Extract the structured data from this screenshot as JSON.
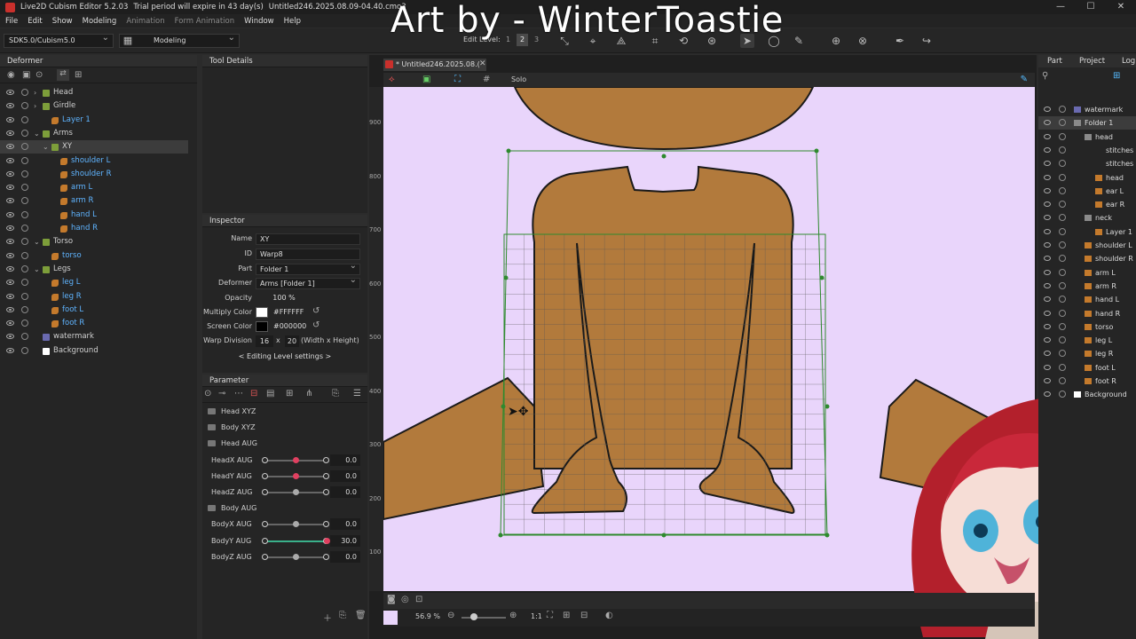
{
  "window": {
    "app_title": "Live2D Cubism Editor 5.2.03",
    "trial_text": "Trial period will expire in 43 day(s)",
    "file_title": "Untitled246.2025.08.09-04.40.cmo3"
  },
  "watermark": "Art by - WinterToastie",
  "menu": [
    "File",
    "Edit",
    "Show",
    "Modeling",
    "Animation",
    "Form Animation",
    "Window",
    "Help"
  ],
  "toolbar": {
    "sdk_select": "SDK5.0/Cubism5.0",
    "mode_select": "Modeling",
    "edit_level_label": "Edit Level:",
    "edit_levels": [
      "1",
      "2",
      "3"
    ],
    "edit_level_selected": "2"
  },
  "deformer_panel": {
    "title": "Deformer",
    "items": [
      {
        "label": "Head",
        "type": "warp",
        "depth": 0,
        "expand": "›"
      },
      {
        "label": "Girdle",
        "type": "warp",
        "depth": 0,
        "expand": "›"
      },
      {
        "label": "Layer 1",
        "type": "art",
        "depth": 1,
        "expand": ""
      },
      {
        "label": "Arms",
        "type": "warp",
        "depth": 0,
        "expand": "⌄"
      },
      {
        "label": "XY",
        "type": "warp",
        "depth": 1,
        "expand": "⌄",
        "selected": true
      },
      {
        "label": "shoulder L",
        "type": "art",
        "depth": 2,
        "expand": ""
      },
      {
        "label": "shoulder R",
        "type": "art",
        "depth": 2,
        "expand": ""
      },
      {
        "label": "arm L",
        "type": "art",
        "depth": 2,
        "expand": ""
      },
      {
        "label": "arm R",
        "type": "art",
        "depth": 2,
        "expand": ""
      },
      {
        "label": "hand L",
        "type": "art",
        "depth": 2,
        "expand": ""
      },
      {
        "label": "hand R",
        "type": "art",
        "depth": 2,
        "expand": ""
      },
      {
        "label": "Torso",
        "type": "warp",
        "depth": 0,
        "expand": "⌄"
      },
      {
        "label": "torso",
        "type": "art",
        "depth": 1,
        "expand": ""
      },
      {
        "label": "Legs",
        "type": "warp",
        "depth": 0,
        "expand": "⌄"
      },
      {
        "label": "leg L",
        "type": "art",
        "depth": 1,
        "expand": ""
      },
      {
        "label": "leg R",
        "type": "art",
        "depth": 1,
        "expand": ""
      },
      {
        "label": "foot L",
        "type": "art",
        "depth": 1,
        "expand": ""
      },
      {
        "label": "foot R",
        "type": "art",
        "depth": 1,
        "expand": ""
      },
      {
        "label": "watermark",
        "type": "wm",
        "depth": 0,
        "expand": ""
      },
      {
        "label": "Background",
        "type": "bg",
        "depth": 0,
        "expand": ""
      }
    ]
  },
  "tool_details": {
    "title": "Tool Details"
  },
  "inspector": {
    "title": "Inspector",
    "name_label": "Name",
    "name_value": "XY",
    "id_label": "ID",
    "id_value": "Warp8",
    "part_label": "Part",
    "part_value": "Folder 1",
    "deformer_label": "Deformer",
    "deformer_value": "Arms [Folder 1]",
    "opacity_label": "Opacity",
    "opacity_value": "100 %",
    "multiply_label": "Multiply Color",
    "multiply_value": "#FFFFFF",
    "screen_label": "Screen Color",
    "screen_value": "#000000",
    "warp_label": "Warp Division",
    "warp_x": "16",
    "warp_x_sep": "x",
    "warp_y": "20",
    "warp_hint": "(Width x Height)",
    "editing_level": "< Editing Level settings >"
  },
  "parameter": {
    "title": "Parameter",
    "groups": [
      {
        "label": "Head XYZ",
        "kind": "folder"
      },
      {
        "label": "Body XYZ",
        "kind": "folder"
      },
      {
        "label": "Head AUG",
        "kind": "folder-open"
      },
      {
        "label": "HeadX AUG",
        "kind": "param",
        "value": "0.0",
        "pos": 0.5,
        "keyed": true
      },
      {
        "label": "HeadY AUG",
        "kind": "param",
        "value": "0.0",
        "pos": 0.5,
        "keyed": true
      },
      {
        "label": "HeadZ AUG",
        "kind": "param",
        "value": "0.0",
        "pos": 0.5,
        "keyed": false
      },
      {
        "label": "Body AUG",
        "kind": "folder-open"
      },
      {
        "label": "BodyX AUG",
        "kind": "param",
        "value": "0.0",
        "pos": 0.5,
        "keyed": false
      },
      {
        "label": "BodyY AUG",
        "kind": "param",
        "value": "30.0",
        "pos": 1.0,
        "keyed": true
      },
      {
        "label": "BodyZ AUG",
        "kind": "param",
        "value": "0.0",
        "pos": 0.5,
        "keyed": false
      }
    ]
  },
  "canvas": {
    "doc_tab": "* Untitled246.2025.08.(",
    "solo_label": "Solo",
    "ruler_ticks": [
      "900",
      "800",
      "700",
      "600",
      "500",
      "400",
      "300",
      "200",
      "100"
    ],
    "zoom": "56.9 %",
    "ratio": "1:1",
    "colors": {
      "background": "#e9d5fb",
      "skin": "#b27a3c",
      "outline": "#1a1a1a",
      "mesh": "#2e8a2e"
    }
  },
  "part_panel": {
    "tabs": [
      "Part",
      "Project",
      "Log"
    ],
    "items": [
      {
        "label": "watermark",
        "depth": 0,
        "icon": "wm"
      },
      {
        "label": "Folder 1",
        "depth": 0,
        "icon": "folder",
        "selected": true
      },
      {
        "label": "head",
        "depth": 1,
        "icon": "folder"
      },
      {
        "label": "stitches",
        "depth": 2,
        "icon": "none"
      },
      {
        "label": "stitches",
        "depth": 2,
        "icon": "none"
      },
      {
        "label": "head",
        "depth": 2,
        "icon": "art"
      },
      {
        "label": "ear L",
        "depth": 2,
        "icon": "art"
      },
      {
        "label": "ear R",
        "depth": 2,
        "icon": "art"
      },
      {
        "label": "neck",
        "depth": 1,
        "icon": "folder"
      },
      {
        "label": "Layer 1",
        "depth": 2,
        "icon": "art"
      },
      {
        "label": "shoulder L",
        "depth": 1,
        "icon": "art"
      },
      {
        "label": "shoulder R",
        "depth": 1,
        "icon": "art"
      },
      {
        "label": "arm L",
        "depth": 1,
        "icon": "art"
      },
      {
        "label": "arm R",
        "depth": 1,
        "icon": "art"
      },
      {
        "label": "hand L",
        "depth": 1,
        "icon": "art"
      },
      {
        "label": "hand R",
        "depth": 1,
        "icon": "art"
      },
      {
        "label": "torso",
        "depth": 1,
        "icon": "art"
      },
      {
        "label": "leg L",
        "depth": 1,
        "icon": "art"
      },
      {
        "label": "leg R",
        "depth": 1,
        "icon": "art"
      },
      {
        "label": "foot L",
        "depth": 1,
        "icon": "art"
      },
      {
        "label": "foot R",
        "depth": 1,
        "icon": "art"
      },
      {
        "label": "Background",
        "depth": 0,
        "icon": "bg"
      }
    ]
  }
}
